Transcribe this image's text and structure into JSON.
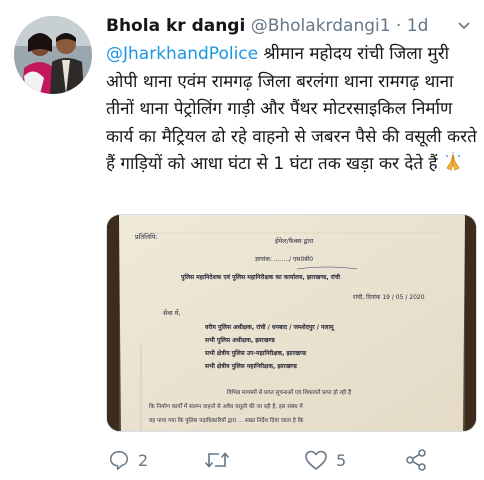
{
  "tweet": {
    "display_name": "Bhola kr dangi",
    "handle": "@Bholakrdangi1",
    "separator": "·",
    "time": "1d",
    "mention": "@JharkhandPolice",
    "text": " श्रीमान महोदय रांची जिला मुरी ओपी थाना एवंम रामगढ़ जिला बरलंगा थाना रामगढ़ थाना तीनों थाना पेट्रोलिंग गाड़ी और पैंथर मोटरसाइकिल निर्माण कार्य का मैट्रियल ढो रहे वाहनो से जबरन पैसे की वसूली करते हैं गाड़ियों को आधा घंटा से 1 घंटा तक खड़ा कर देते हैं",
    "emoji": "folded-hands"
  },
  "document": {
    "lines": [
      "प्रतिलिपि:",
      "ईमेल/फैक्स द्वारा",
      "ज्ञापांक: ......../ एस0बी0",
      "पुलिस महानिदेशक एवं पुलिस महानिरीक्षक का कार्यालय, झारखण्ड, रांची",
      "रांची, दिनांक 19 / 05 / 2020",
      "सेवा में,",
      "वरीय पुलिस अधीक्षक, रांची / धनबाद / जमशेदपुर / पलामू",
      "सभी पुलिस अधीक्षक, झारखण्ड",
      "सभी क्षेत्रीय पुलिस उप-महानिरीक्षक, झारखण्ड",
      "सभी क्षेत्रीय पुलिस महानिरीक्षक, झारखण्ड",
      "विभिन्न माध्यमों से प्राप्त सूचनाओं एवं शिकायतें प्राप्त हो रही हैं",
      "कि निर्माण कार्यों में संलग्न वाहनों से अवैध वसूली की जा रही है, इस संबंध में",
      "यह पाया गया कि पुलिस पदाधिकारियों द्वारा ... सख्त निर्देश दिया जाता है कि"
    ]
  },
  "actions": {
    "reply_count": "2",
    "retweet_count": "",
    "like_count": "5",
    "share_count": ""
  },
  "icons": {
    "reply": "reply-icon",
    "retweet": "retweet-icon",
    "like": "heart-icon",
    "share": "share-icon",
    "caret": "chevron-down-icon"
  },
  "colors": {
    "link": "#1b95e0",
    "muted": "#657786",
    "text": "#14171a"
  }
}
